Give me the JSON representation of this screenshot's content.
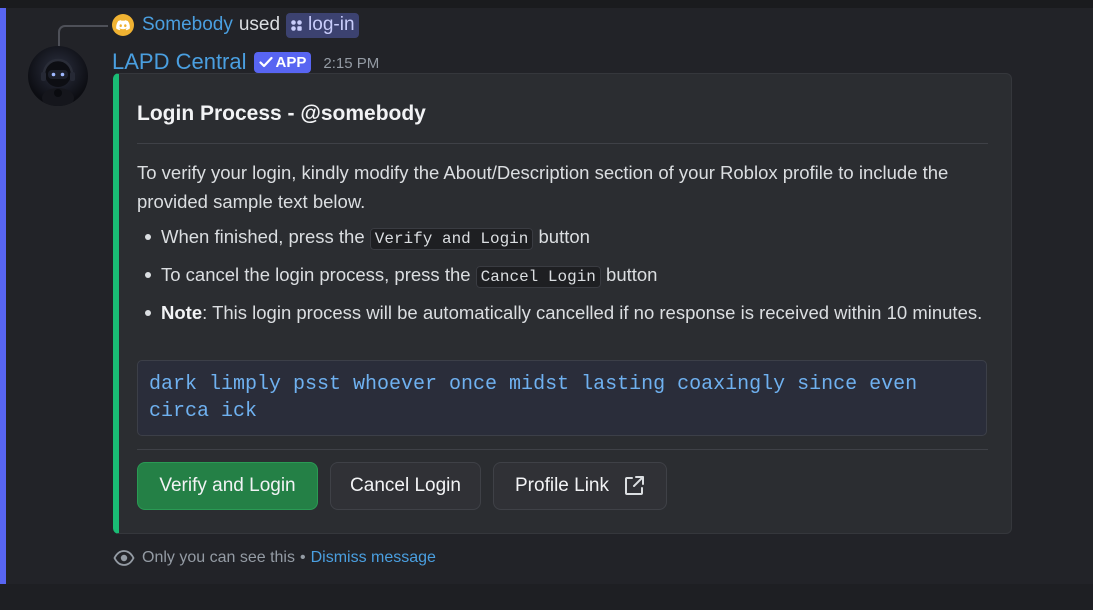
{
  "reply": {
    "user": "Somebody",
    "used": "used",
    "command": "log-in"
  },
  "author": {
    "name": "LAPD Central",
    "badge": "APP",
    "time": "2:15 PM"
  },
  "embed": {
    "accent_color": "#1abc75",
    "title": "Login Process - @somebody",
    "description": "To verify your login, kindly modify the About/Description section of your Roblox profile to include the provided sample text below.",
    "bullet1_pre": "When finished, press the ",
    "bullet1_code": "Verify and Login",
    "bullet1_post": " button",
    "bullet2_pre": "To cancel the login process, press the ",
    "bullet2_code": "Cancel Login",
    "bullet2_post": " button",
    "bullet3_bold": "Note",
    "bullet3_text": ": This login process will be automatically cancelled if no response is received within 10 minutes.",
    "sample_text": "dark limply psst whoever once midst lasting coaxingly since even circa ick"
  },
  "buttons": {
    "verify": "Verify and Login",
    "cancel": "Cancel Login",
    "profile": "Profile Link"
  },
  "footer": {
    "notice": "Only you can see this",
    "separator": "•",
    "dismiss": "Dismiss message"
  },
  "icons": {
    "reply_avatar": "discord-icon",
    "command": "app-command-icon",
    "badge_check": "checkmark-icon",
    "external_link": "external-link-icon",
    "visibility": "eye-icon"
  }
}
